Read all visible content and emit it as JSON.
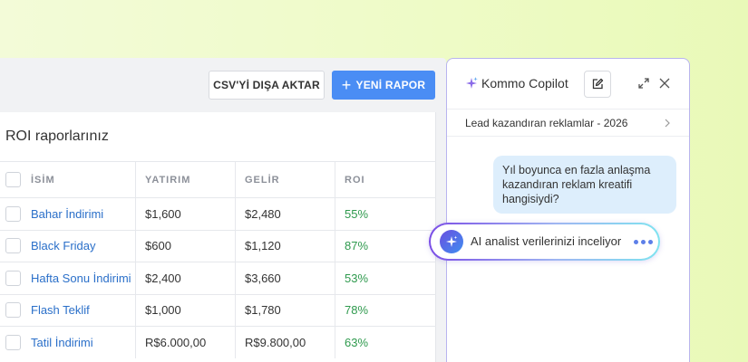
{
  "toolbar": {
    "export_label": "CSV'Yİ DIŞA AKTAR",
    "new_report_label": "YENİ RAPOR"
  },
  "table": {
    "title": "ROI raporlarınız",
    "headers": {
      "name": "İSİM",
      "investment": "YATIRIM",
      "revenue": "GELİR",
      "roi": "ROI"
    },
    "rows": [
      {
        "name": "Bahar İndirimi",
        "investment": "$1,600",
        "revenue": "$2,480",
        "roi": "55%"
      },
      {
        "name": "Black Friday",
        "investment": "$600",
        "revenue": "$1,120",
        "roi": "87%"
      },
      {
        "name": "Hafta Sonu İndirimi",
        "investment": "$2,400",
        "revenue": "$3,660",
        "roi": "53%"
      },
      {
        "name": "Flash Teklif",
        "investment": "$1,000",
        "revenue": "$1,780",
        "roi": "78%"
      },
      {
        "name": "Tatil İndirimi",
        "investment": "R$6.000,00",
        "revenue": "R$9.800,00",
        "roi": "63%"
      }
    ]
  },
  "copilot": {
    "title": "Kommo Copilot",
    "context_label": "Lead kazandıran reklamlar  - 2026",
    "user_message": "Yıl boyunca en fazla anlaşma kazandıran reklam kreatifi hangisiydi?",
    "status_text": "AI analist verilerinizi inceliyor"
  },
  "colors": {
    "accent_blue": "#4a8df4",
    "roi_green": "#2f9a4e",
    "link_blue": "#2a6fc9",
    "copilot_border": "#b9b4ef",
    "user_bubble": "#ddeefc"
  },
  "icons": {
    "sparkle": "sparkle-icon",
    "edit": "edit-icon",
    "expand": "expand-icon",
    "close": "close-icon",
    "chevron": "chevron-right-icon",
    "plus": "plus-icon"
  }
}
